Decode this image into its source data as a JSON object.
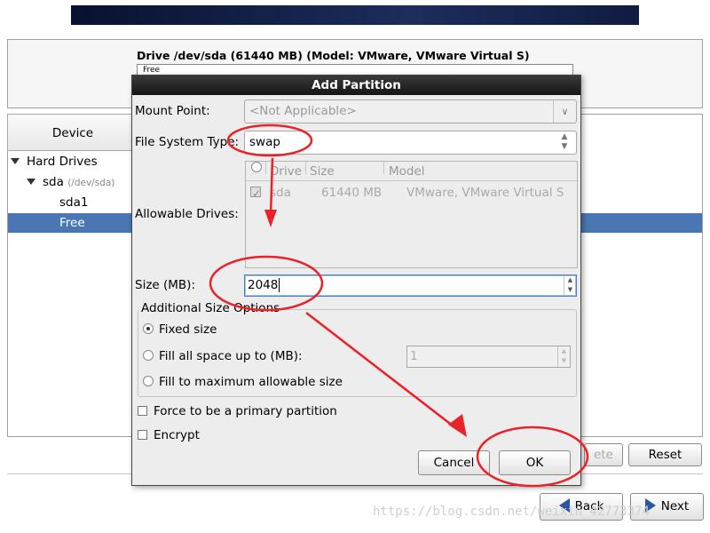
{
  "window": {
    "drive_title": "Drive /dev/sda (61440 MB) (Model: VMware, VMware Virtual S)",
    "drive_bar_label": "Free"
  },
  "device_tree": {
    "header": "Device",
    "root": "Hard Drives",
    "disk_name": "sda",
    "disk_path": "(/dev/sda)",
    "partition": "sda1",
    "free": "Free"
  },
  "background_buttons": {
    "delete": "ete",
    "reset": "Reset",
    "back": "Back",
    "next": "Next"
  },
  "dialog": {
    "title": "Add Partition",
    "mount_point_label": "Mount Point:",
    "mount_point_value": "<Not Applicable>",
    "fs_type_label": "File System Type:",
    "fs_type_value": "swap",
    "allowable_drives_label": "Allowable Drives:",
    "drives_columns": [
      "Drive",
      "Size",
      "Model"
    ],
    "drives_rows": [
      {
        "checked": true,
        "drive": "sda",
        "size": "61440 MB",
        "model": "VMware, VMware Virtual S"
      }
    ],
    "size_label": "Size (MB):",
    "size_value": "2048",
    "size_options_legend": "Additional Size Options",
    "options": [
      {
        "label": "Fixed size",
        "selected": true
      },
      {
        "label": "Fill all space up to (MB):",
        "selected": false
      },
      {
        "label": "Fill to maximum allowable size",
        "selected": false
      }
    ],
    "fill_up_to_value": "1",
    "primary_partition_label": "Force to be a primary partition",
    "encrypt_label": "Encrypt",
    "cancel_label": "Cancel",
    "ok_label": "OK"
  },
  "watermark": "https://blog.csdn.net/weixin_42773374",
  "colors": {
    "annotation": "#e8232a",
    "selection": "#4a77b3",
    "title_bar": "#1f1f1f"
  }
}
